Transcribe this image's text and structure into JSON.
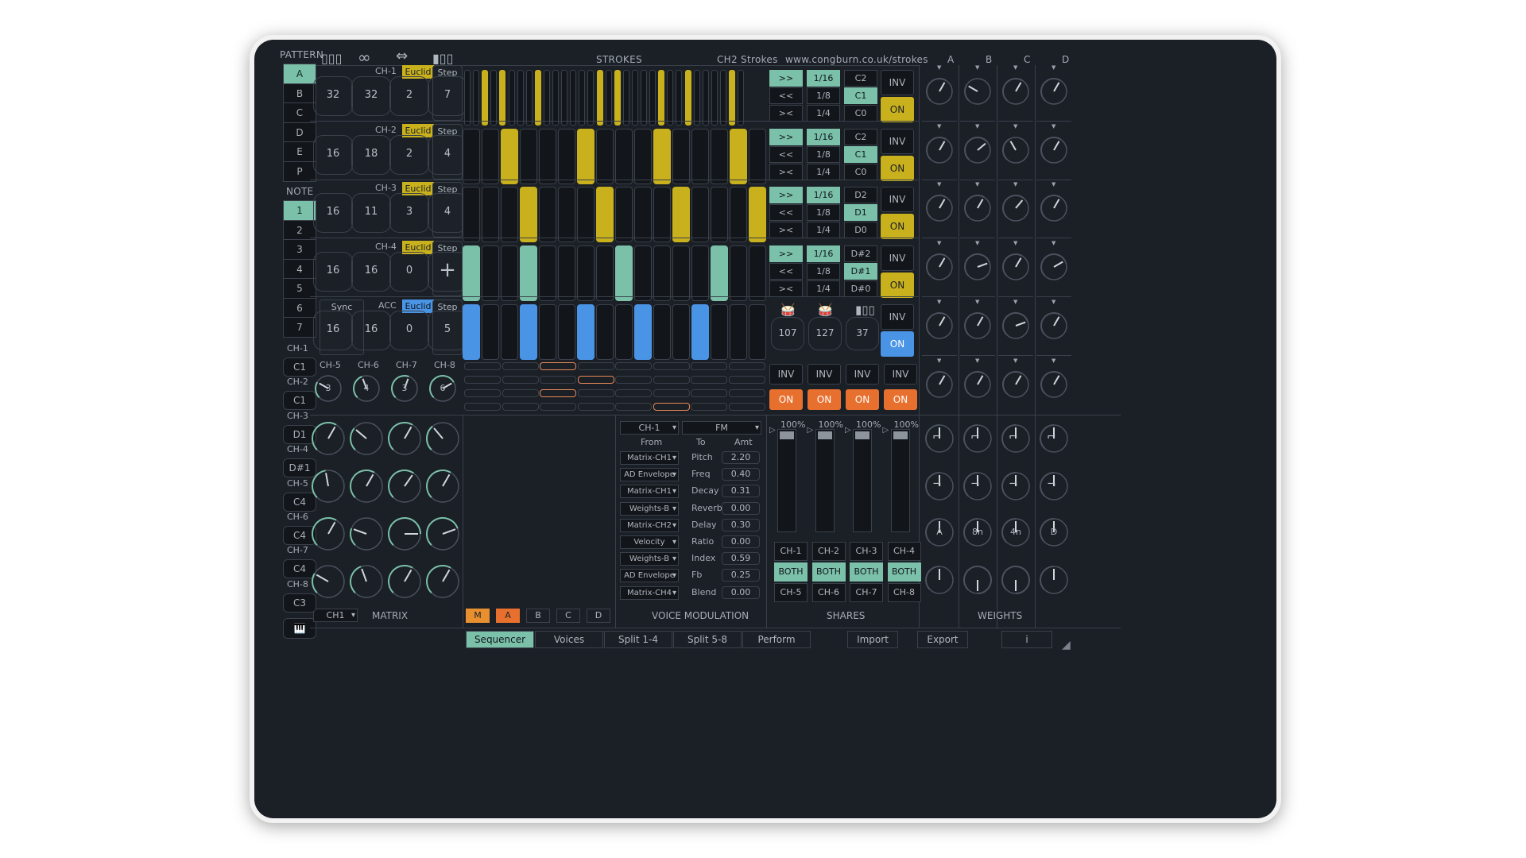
{
  "pattern_label": "PATTERN",
  "patterns": [
    "A",
    "B",
    "C",
    "D",
    "E",
    "P"
  ],
  "note_label": "NOTE",
  "notes": [
    "1",
    "2",
    "3",
    "4",
    "5",
    "6",
    "7"
  ],
  "ch_side": [
    {
      "name": "CH-1",
      "val": "C1"
    },
    {
      "name": "CH-2",
      "val": "C1"
    },
    {
      "name": "CH-3",
      "val": "D1"
    },
    {
      "name": "CH-4",
      "val": "D#1"
    },
    {
      "name": "CH-5",
      "val": "C4"
    },
    {
      "name": "CH-6",
      "val": "C4"
    },
    {
      "name": "CH-7",
      "val": "C4"
    },
    {
      "name": "CH-8",
      "val": "C3"
    }
  ],
  "header": {
    "strokes": "STROKES",
    "preset": "CH2 Strokes",
    "url": "www.congburn.co.uk/strokes"
  },
  "weight_cols": [
    "A",
    "B",
    "C",
    "D"
  ],
  "channels": [
    {
      "name": "CH-1",
      "euclid": "Euclid",
      "step": "Step",
      "vals": [
        "32",
        "32",
        "2",
        "7"
      ]
    },
    {
      "name": "CH-2",
      "euclid": "Euclid",
      "step": "Step",
      "vals": [
        "16",
        "18",
        "2",
        "4"
      ]
    },
    {
      "name": "CH-3",
      "euclid": "Euclid",
      "step": "Step",
      "vals": [
        "16",
        "11",
        "3",
        "4"
      ]
    },
    {
      "name": "CH-4",
      "euclid": "Euclid",
      "step": "Step",
      "vals": [
        "16",
        "16",
        "0",
        "+"
      ]
    }
  ],
  "acc_row": {
    "sync": "Sync",
    "acc": "ACC",
    "euclid": "Euclid",
    "step": "Step",
    "vals": [
      "16",
      "16",
      "0",
      "5"
    ]
  },
  "rate_groups": [
    {
      "dir": [
        ">>",
        "<<",
        "><"
      ],
      "div": [
        "1/16",
        "1/8",
        "1/4"
      ],
      "oct": [
        "C2",
        "C1",
        "C0"
      ],
      "inv": "INV",
      "on": "ON"
    },
    {
      "dir": [
        ">>",
        "<<",
        "><"
      ],
      "div": [
        "1/16",
        "1/8",
        "1/4"
      ],
      "oct": [
        "C2",
        "C1",
        "C0"
      ],
      "inv": "INV",
      "on": "ON"
    },
    {
      "dir": [
        ">>",
        "<<",
        "><"
      ],
      "div": [
        "1/16",
        "1/8",
        "1/4"
      ],
      "oct": [
        "D2",
        "D1",
        "D0"
      ],
      "inv": "INV",
      "on": "ON"
    },
    {
      "dir": [
        ">>",
        "<<",
        "><"
      ],
      "div": [
        "1/16",
        "1/8",
        "1/4"
      ],
      "oct": [
        "D#2",
        "D#1",
        "D#0"
      ],
      "inv": "INV",
      "on": "ON"
    }
  ],
  "acc_vals": [
    "107",
    "127",
    "37"
  ],
  "acc_inv": "INV",
  "acc_on": "ON",
  "lower_ch": [
    {
      "name": "CH-5",
      "val": "3"
    },
    {
      "name": "CH-6",
      "val": "4"
    },
    {
      "name": "CH-7",
      "val": "3"
    },
    {
      "name": "CH-8",
      "val": "6"
    }
  ],
  "lower_inv": [
    "INV",
    "INV",
    "INV",
    "INV"
  ],
  "lower_on": [
    "ON",
    "ON",
    "ON",
    "ON"
  ],
  "matrix": {
    "ch": "CH1",
    "label": "MATRIX",
    "tabs": [
      "M",
      "A",
      "B",
      "C",
      "D"
    ]
  },
  "voice_mod": {
    "ch": "CH-1",
    "type": "FM",
    "from": "From",
    "to": "To",
    "amt": "Amt",
    "label": "VOICE MODULATION",
    "rows": [
      {
        "from": "Matrix-CH1",
        "to": "Pitch",
        "amt": "2.20"
      },
      {
        "from": "AD Envelope",
        "to": "Freq",
        "amt": "0.40"
      },
      {
        "from": "Matrix-CH1",
        "to": "Decay",
        "amt": "0.31"
      },
      {
        "from": "Weights-B",
        "to": "Reverb",
        "amt": "0.00"
      },
      {
        "from": "Matrix-CH2",
        "to": "Delay",
        "amt": "0.30"
      },
      {
        "from": "Velocity",
        "to": "Ratio",
        "amt": "0.00"
      },
      {
        "from": "Weights-B",
        "to": "Index",
        "amt": "0.59"
      },
      {
        "from": "AD Envelope",
        "to": "Fb",
        "amt": "0.25"
      },
      {
        "from": "Matrix-CH4",
        "to": "Blend",
        "amt": "0.00"
      }
    ]
  },
  "shares": {
    "label": "SHARES",
    "pct": [
      "100%",
      "100%",
      "100%",
      "100%"
    ],
    "top": [
      "CH-1",
      "CH-2",
      "CH-3",
      "CH-4"
    ],
    "both": [
      "BOTH",
      "BOTH",
      "BOTH",
      "BOTH"
    ],
    "bottom": [
      "CH-5",
      "CH-6",
      "CH-7",
      "CH-8"
    ]
  },
  "weights": {
    "label": "WEIGHTS",
    "knob_labels": [
      "A",
      "8n",
      "4n",
      "D"
    ]
  },
  "tabs": [
    "Sequencer",
    "Voices",
    "Split 1-4",
    "Split 5-8",
    "Perform"
  ],
  "import": "Import",
  "export": "Export",
  "info": "i",
  "colors": {
    "bg": "#1b1f26",
    "teal": "#7bc0a8",
    "yellow": "#c8b11d",
    "blue": "#4a94e6",
    "orange": "#e8702f"
  }
}
